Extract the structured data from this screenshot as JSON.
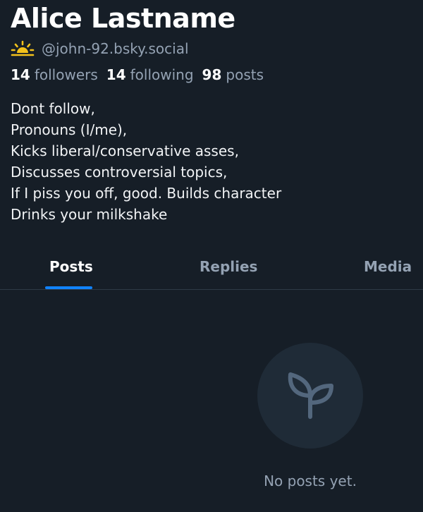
{
  "profile": {
    "display_name": "Alice Lastname",
    "avatar_icon": "sun-icon",
    "handle": "@john-92.bsky.social",
    "stats": {
      "followers_count": "14",
      "followers_label": "followers",
      "following_count": "14",
      "following_label": "following",
      "posts_count": "98",
      "posts_label": "posts"
    },
    "bio": [
      "Dont follow,",
      "Pronouns (I/me),",
      "Kicks liberal/conservative asses,",
      "Discusses controversial topics,",
      "If I piss you off, good. Builds character",
      "Drinks your milkshake"
    ]
  },
  "tabs": {
    "items": [
      {
        "label": "Posts",
        "active": true
      },
      {
        "label": "Replies",
        "active": false
      },
      {
        "label": "Media",
        "active": false
      }
    ]
  },
  "empty_state": {
    "icon": "sprout-icon",
    "message": "No posts yet."
  },
  "colors": {
    "background": "#161e27",
    "accent": "#1083fe",
    "muted_text": "#94a2b3",
    "sun_yellow": "#f4c21b"
  }
}
